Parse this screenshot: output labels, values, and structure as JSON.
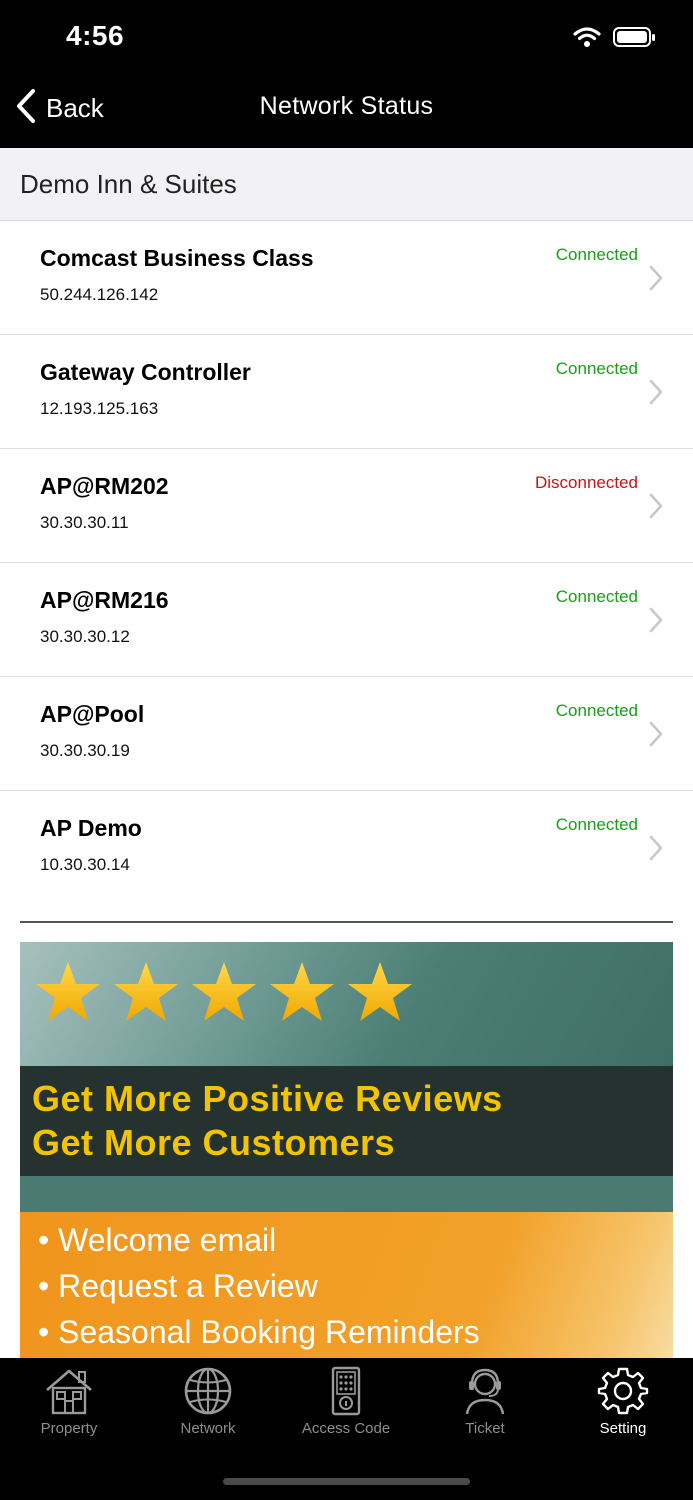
{
  "status_bar": {
    "time": "4:56",
    "wifi_icon": "wifi-icon",
    "battery_icon": "battery-icon"
  },
  "nav": {
    "back_label": "Back",
    "title": "Network Status",
    "back_icon": "chevron-left-icon"
  },
  "property": {
    "name": "Demo Inn & Suites"
  },
  "colors": {
    "connected": "#1a9e1a",
    "disconnected": "#c81414",
    "chevron": "#c7c7cc"
  },
  "devices": [
    {
      "name": "Comcast Business Class",
      "ip": "50.244.126.142",
      "status": "Connected"
    },
    {
      "name": "Gateway Controller",
      "ip": "12.193.125.163",
      "status": "Connected"
    },
    {
      "name": "AP@RM202",
      "ip": "30.30.30.11",
      "status": "Disconnected"
    },
    {
      "name": "AP@RM216",
      "ip": "30.30.30.12",
      "status": "Connected"
    },
    {
      "name": "AP@Pool",
      "ip": "30.30.30.19",
      "status": "Connected"
    },
    {
      "name": "AP Demo",
      "ip": "10.30.30.14",
      "status": "Connected"
    }
  ],
  "banner": {
    "rating_stars": 5,
    "headline_1": "Get More Positive Reviews",
    "headline_2": "Get More Customers",
    "bullets": [
      "• Welcome email",
      "• Request a Review",
      "• Seasonal Booking Reminders"
    ]
  },
  "tabbar": {
    "tabs": [
      {
        "label": "Property",
        "icon": "house-icon"
      },
      {
        "label": "Network",
        "icon": "globe-icon"
      },
      {
        "label": "Access Code",
        "icon": "keypad-lock-icon"
      },
      {
        "label": "Ticket",
        "icon": "headset-agent-icon"
      },
      {
        "label": "Setting",
        "icon": "gear-icon"
      }
    ],
    "active": "Setting"
  }
}
